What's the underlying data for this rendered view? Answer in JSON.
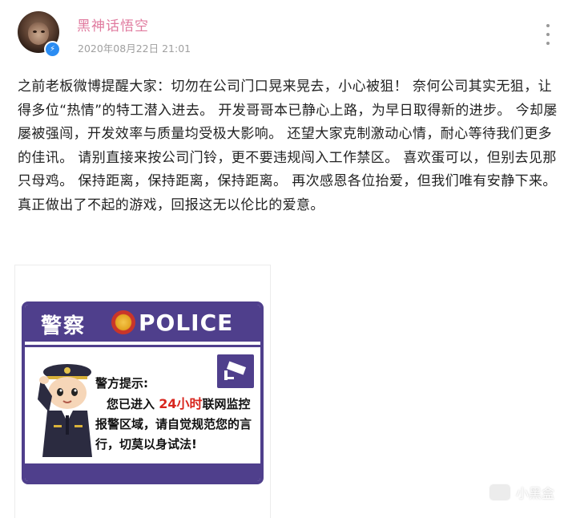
{
  "author": {
    "name": "黑神话悟空",
    "timestamp": "2020年08月22日 21:01",
    "verified_badge_icon": "verified-badge-icon"
  },
  "menu": {
    "icon": "more-vertical-icon"
  },
  "post": {
    "text": "之前老板微博提醒大家：切勿在公司门口晃来晃去，小心被狙！ 奈何公司其实无狙，让得多位“热情”的特工潜入进去。 开发哥哥本已静心上路，为早日取得新的进步。 今却屡屡被强闯，开发效率与质量均受极大影响。 还望大家克制激动心情，耐心等待我们更多的佳讯。 请别直接来按公司门铃，更不要违规闯入工作禁区。 喜欢蛋可以，但别去见那只母鸡。 保持距离，保持距离，保持距离。 再次感恩各位抬爱，但我们唯有安静下来。 真正做出了不起的游戏，回报这无以伦比的爱意。"
  },
  "image": {
    "sign_cn": "警察",
    "sign_en": "POLICE",
    "notice_title": "警方提示:",
    "notice_line1_pre": "您已进入",
    "notice_line1_red": "24小时",
    "notice_line1_post": "联网监控",
    "notice_line2": "报警区域，请自觉规范您的言",
    "notice_line3": "行，切莫以身试法!"
  },
  "watermark": {
    "text": "小黑盒"
  },
  "colors": {
    "username": "#e07b9f",
    "sign_purple": "#4f3f8c",
    "notice_red": "#d8261e",
    "verified_blue": "#2b8cf2"
  }
}
